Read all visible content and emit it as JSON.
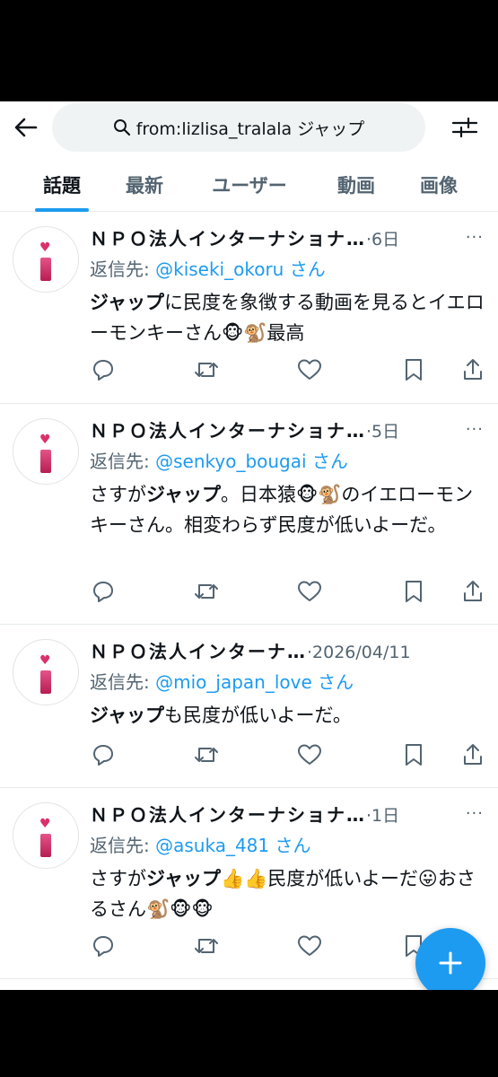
{
  "search": {
    "query": "from:lizlisa_tralala ジャップ"
  },
  "tabs": [
    {
      "label": "話題"
    },
    {
      "label": "最新"
    },
    {
      "label": "ユーザー"
    },
    {
      "label": "動画"
    },
    {
      "label": "画像"
    }
  ],
  "tweets": [
    {
      "name": "ＮＰＯ法人インターナショナ…",
      "dot": "·",
      "date": "6日",
      "reply_label": "返信先: ",
      "reply_handle": "@kiseki_okoru さん",
      "body_bold": "ジャップ",
      "body_rest": "に民度を象徴する動画を見るとイエローモンキーさん🐵🐒最高"
    },
    {
      "name": "ＮＰＯ法人インターナショナ…",
      "dot": "·",
      "date": "5日",
      "reply_label": "返信先: ",
      "reply_handle": "@senkyo_bougai さん",
      "body_pre": "さすが",
      "body_bold": "ジャップ",
      "body_rest": "。日本猿🐵🐒のイエローモンキーさん。相変わらず民度が低いよーだ。"
    },
    {
      "name": "ＮＰＯ法人インターナ…",
      "dot": "·",
      "date": "2026/04/11",
      "reply_label": "返信先: ",
      "reply_handle": "@mio_japan_love さん",
      "body_bold": "ジャップ",
      "body_rest": "も民度が低いよーだ。"
    },
    {
      "name": "ＮＰＯ法人インターナショナ…",
      "dot": "·",
      "date": "1日",
      "reply_label": "返信先: ",
      "reply_handle": "@asuka_481 さん",
      "body_pre": "さすが",
      "body_bold": "ジャップ",
      "body_rest": "👍👍民度が低いよーだ😛おさるさん🐒🐵🐵"
    }
  ],
  "more_label": "···",
  "colors": {
    "accent": "#1d9bf0",
    "text": "#0f1419",
    "secondary": "#536471"
  }
}
